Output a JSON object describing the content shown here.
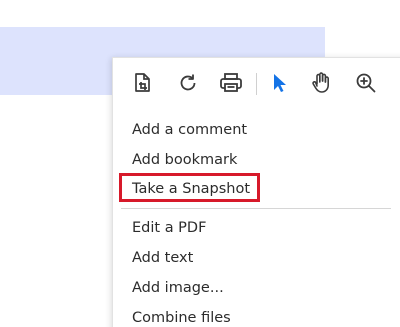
{
  "toolbar": {
    "tools": [
      {
        "icon": "page-crop-icon"
      },
      {
        "icon": "rotate-icon"
      },
      {
        "icon": "print-icon"
      },
      {
        "icon": "select-cursor-icon"
      },
      {
        "icon": "hand-tool-icon"
      },
      {
        "icon": "zoom-in-icon"
      }
    ],
    "accent_color": "#1473e6"
  },
  "menu": {
    "group1": [
      "Add a comment",
      "Add bookmark",
      "Take a Snapshot"
    ],
    "group2": [
      "Edit a PDF",
      "Add text",
      "Add image...",
      "Combine files"
    ]
  },
  "highlight": {
    "selected_item": "Take a Snapshot",
    "color": "#d7192a"
  }
}
